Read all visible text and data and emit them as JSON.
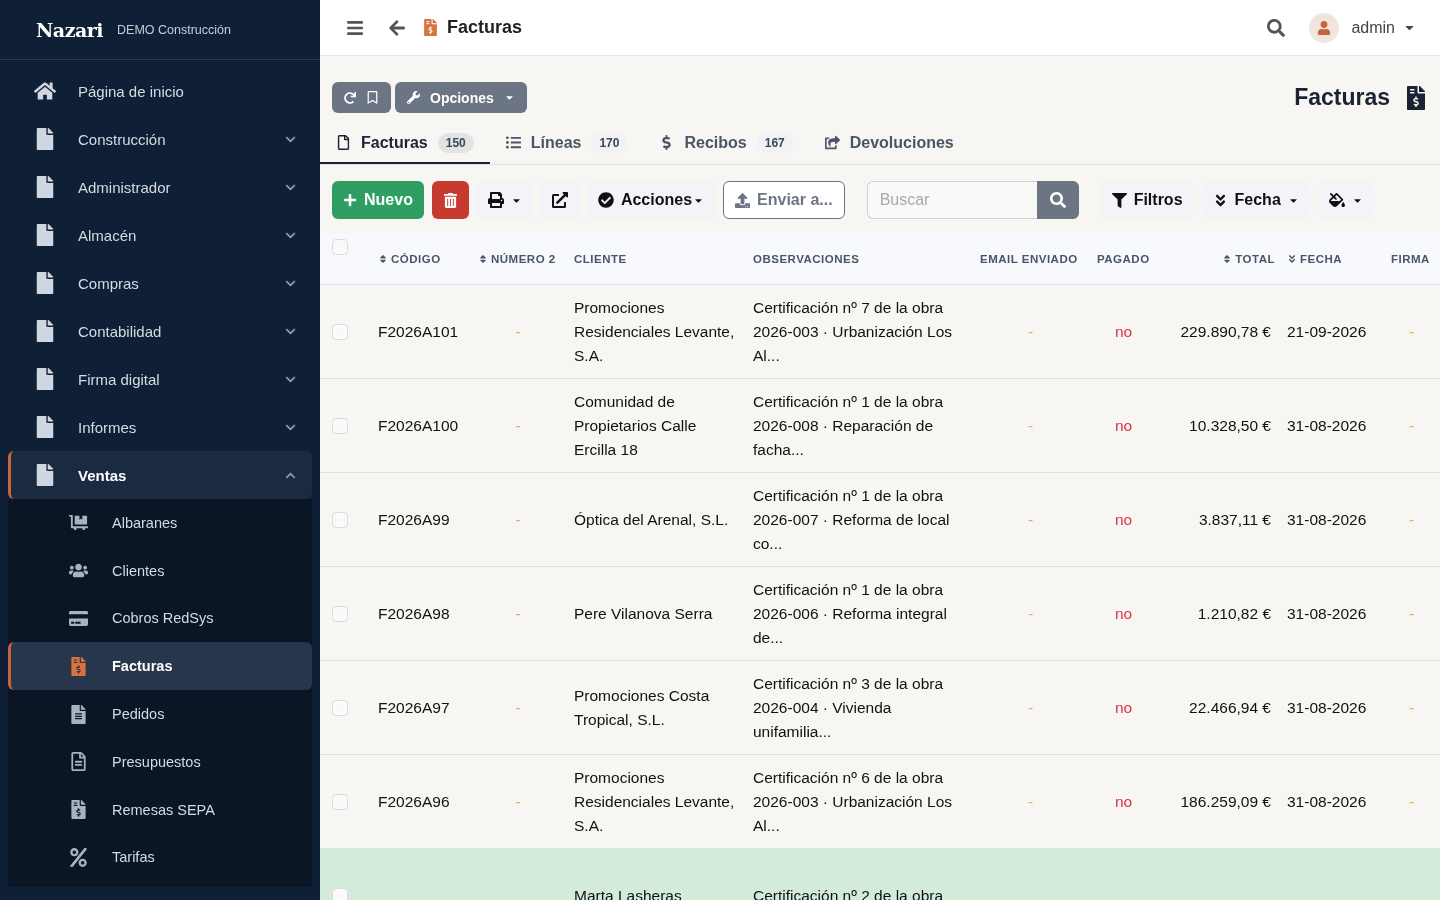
{
  "brand": {
    "logo": "Nazari",
    "company": "DEMO Construcción"
  },
  "sidebar": {
    "items": [
      {
        "label": "Página de inicio",
        "kind": "link"
      },
      {
        "label": "Construcción",
        "kind": "group",
        "expanded": false
      },
      {
        "label": "Administrador",
        "kind": "group",
        "expanded": false
      },
      {
        "label": "Almacén",
        "kind": "group",
        "expanded": false
      },
      {
        "label": "Compras",
        "kind": "group",
        "expanded": false
      },
      {
        "label": "Contabilidad",
        "kind": "group",
        "expanded": false
      },
      {
        "label": "Firma digital",
        "kind": "group",
        "expanded": false
      },
      {
        "label": "Informes",
        "kind": "group",
        "expanded": false
      },
      {
        "label": "Ventas",
        "kind": "group",
        "expanded": true,
        "children": [
          {
            "label": "Albaranes",
            "selected": false
          },
          {
            "label": "Clientes",
            "selected": false
          },
          {
            "label": "Cobros RedSys",
            "selected": false
          },
          {
            "label": "Facturas",
            "selected": true
          },
          {
            "label": "Pedidos",
            "selected": false
          },
          {
            "label": "Presupuestos",
            "selected": false
          },
          {
            "label": "Remesas SEPA",
            "selected": false
          },
          {
            "label": "Tarifas",
            "selected": false
          }
        ]
      }
    ]
  },
  "topbar": {
    "title": "Facturas",
    "user": "admin"
  },
  "page": {
    "heading": "Facturas",
    "options": "Opciones"
  },
  "tabs": [
    {
      "label": "Facturas",
      "count": "150",
      "selected": true
    },
    {
      "label": "Líneas",
      "count": "170",
      "selected": false
    },
    {
      "label": "Recibos",
      "count": "167",
      "selected": false
    },
    {
      "label": "Devoluciones",
      "selected": false
    }
  ],
  "toolbar": {
    "new": "Nuevo",
    "actions": "Acciones",
    "send": "Enviar a...",
    "search": {
      "placeholder": "Buscar"
    },
    "filters": "Filtros",
    "sort": "Fecha"
  },
  "table": {
    "all_checked": false,
    "columns": [
      {
        "label": "CÓDIGO",
        "sortable": true,
        "sorted": false
      },
      {
        "label": "NÚMERO 2",
        "sortable": true,
        "sorted": false
      },
      {
        "label": "CLIENTE",
        "sortable": false,
        "sorted": false
      },
      {
        "label": "OBSERVACIONES",
        "sortable": false,
        "sorted": false
      },
      {
        "label": "EMAIL ENVIADO",
        "sortable": false,
        "sorted": false
      },
      {
        "label": "PAGADO",
        "sortable": false,
        "sorted": false
      },
      {
        "label": "TOTAL",
        "sortable": true,
        "sorted": false
      },
      {
        "label": "FECHA",
        "sortable": true,
        "sorted": true
      },
      {
        "label": "FIRMA",
        "sortable": false,
        "sorted": false
      }
    ],
    "rows": [
      {
        "checked": false,
        "highlighted": false,
        "cells": [
          "F2026A101",
          "-",
          "Promociones Residenciales Levante, S.A.",
          "Certificación nº 7 de la obra 2026-003 · Urbanización Los Al...",
          "-",
          "no",
          "229.890,78 €",
          "21-09-2026",
          "-"
        ]
      },
      {
        "checked": false,
        "highlighted": false,
        "cells": [
          "F2026A100",
          "-",
          "Comunidad de Propietarios Calle Ercilla 18",
          "Certificación nº 1 de la obra 2026-008 · Reparación de facha...",
          "-",
          "no",
          "10.328,50 €",
          "31-08-2026",
          "-"
        ]
      },
      {
        "checked": false,
        "highlighted": false,
        "cells": [
          "F2026A99",
          "-",
          "Óptica del Arenal, S.L.",
          "Certificación nº 1 de la obra 2026-007 · Reforma de local co...",
          "-",
          "no",
          "3.837,11 €",
          "31-08-2026",
          "-"
        ]
      },
      {
        "checked": false,
        "highlighted": false,
        "cells": [
          "F2026A98",
          "-",
          "Pere Vilanova Serra",
          "Certificación nº 1 de la obra 2026-006 · Reforma integral de...",
          "-",
          "no",
          "1.210,82 €",
          "31-08-2026",
          "-"
        ]
      },
      {
        "checked": false,
        "highlighted": false,
        "cells": [
          "F2026A97",
          "-",
          "Promociones Costa Tropical, S.L.",
          "Certificación nº 3 de la obra 2026-004 · Vivienda unifamilia...",
          "-",
          "no",
          "22.466,94 €",
          "31-08-2026",
          "-"
        ]
      },
      {
        "checked": false,
        "highlighted": false,
        "cells": [
          "F2026A96",
          "-",
          "Promociones Residenciales Levante, S.A.",
          "Certificación nº 6 de la obra 2026-003 · Urbanización Los Al...",
          "-",
          "no",
          "186.259,09 €",
          "31-08-2026",
          "-"
        ]
      },
      {
        "checked": false,
        "highlighted": true,
        "cells": [
          null,
          null,
          "Marta Lasheras",
          "Certificación nº 2 de la obra",
          null,
          null,
          null,
          null,
          null
        ]
      }
    ]
  }
}
